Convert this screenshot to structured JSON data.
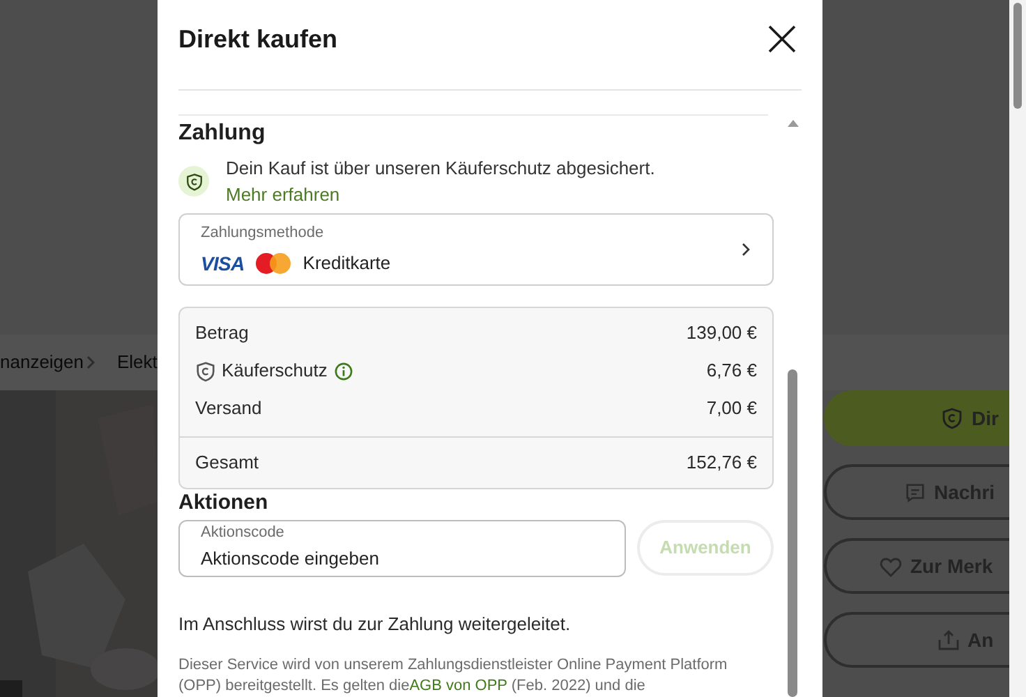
{
  "background_page": {
    "breadcrumb": [
      "nanzeigen",
      "Elekt"
    ],
    "action_buttons": [
      {
        "label": "Dir",
        "kind": "primary"
      },
      {
        "label": "Nachri",
        "kind": "message"
      },
      {
        "label": "Zur Merk",
        "kind": "watch"
      },
      {
        "label": "An",
        "kind": "share"
      }
    ]
  },
  "dialog": {
    "title": "Direkt kaufen",
    "payment": {
      "heading": "Zahlung",
      "note": "Dein Kauf ist über unseren Käuferschutz abgesichert.",
      "note_link": "Mehr erfahren",
      "method_label": "Zahlungsmethode",
      "card_brand": "VISA",
      "method": "Kreditkarte"
    },
    "summary": {
      "rows": [
        {
          "label": "Betrag",
          "value": "139,00 €",
          "kind": "plain"
        },
        {
          "label": "Käuferschutz",
          "value": "6,76 €",
          "kind": "protection"
        },
        {
          "label": "Versand",
          "value": "7,00 €",
          "kind": "plain"
        }
      ],
      "total": {
        "label": "Gesamt",
        "value": "152,76 €"
      }
    },
    "promo": {
      "heading": "Aktionen",
      "field_label": "Aktionscode",
      "placeholder": "Aktionscode eingeben",
      "button": "Anwenden",
      "disabled": true
    },
    "redirect_note": "Im Anschluss wirst du zur Zahlung weitergeleitet.",
    "legal": {
      "before": "Dieser Service wird von unserem Zahlungsdienstleister Online Payment Platform (OPP) bereitgestellt. Es gelten die",
      "link": "AGB von OPP",
      "after": " (Feb. 2022) und die"
    }
  }
}
